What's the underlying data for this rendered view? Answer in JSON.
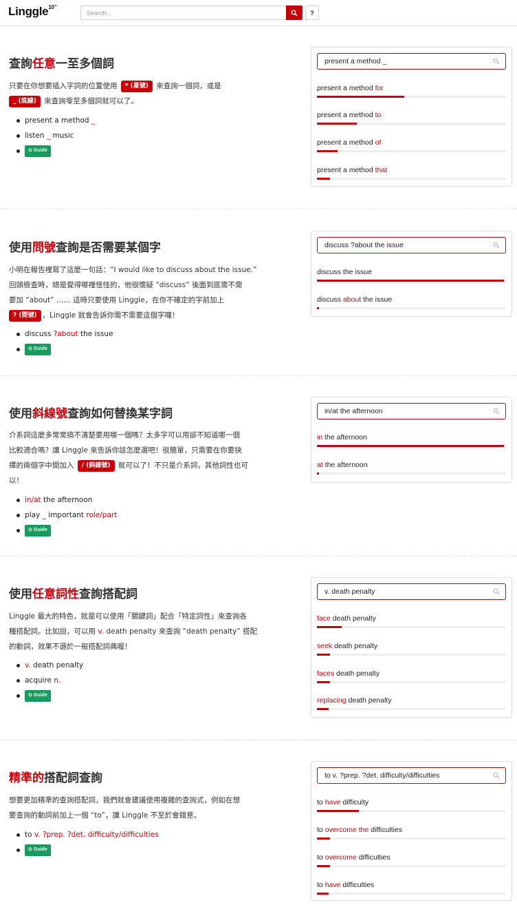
{
  "header": {
    "logo_text": "Linggle",
    "logo_sup": "10",
    "logo_mark": "\"",
    "search_placeholder": "Search...",
    "help_label": "?"
  },
  "colors": {
    "accent": "#c8000a",
    "guide": "#1a9a5c"
  },
  "guide_label": "Guide",
  "sections": [
    {
      "title": [
        "查詢",
        "任意",
        "一至多個詞"
      ],
      "body": [
        "只要在你想要插入字詞的位置使用",
        "* (星號)",
        "來查詢一個詞，或是",
        "_ (底線)",
        "來查詢零至多個詞就可以了。"
      ],
      "examples": [
        [
          "present a method ",
          "_"
        ],
        [
          "listen ",
          "_",
          " music"
        ]
      ],
      "panel": {
        "query": "present a method _",
        "results": [
          {
            "prefix": "present a method ",
            "hl": "for",
            "suffix": "",
            "ratio": 0.46
          },
          {
            "prefix": "present a method ",
            "hl": "to",
            "suffix": "",
            "ratio": 0.21
          },
          {
            "prefix": "present a method ",
            "hl": "of",
            "suffix": "",
            "ratio": 0.11
          },
          {
            "prefix": "present a method ",
            "hl": "that",
            "suffix": "",
            "ratio": 0.07
          }
        ]
      }
    },
    {
      "title": [
        "使用",
        "問號",
        "查詢是否需要某個字"
      ],
      "body": [
        "小明在報告裡寫了這麼一句話：“I would like to discuss about the issue.”",
        "回頭檢查時，總是覺得哪裡怪怪的，他很懷疑 “discuss” 後面到底需不需",
        "要加 “about” …… 這時只要使用 Linggle，在你不確定的字前加上",
        "? (問號)",
        "，Linggle 就會告訴你需不需要這個字囉！"
      ],
      "examples": [
        [
          "discuss ",
          "?about",
          " the issue"
        ]
      ],
      "panel": {
        "query": "discuss ?about the issue",
        "results": [
          {
            "prefix": "discuss the issue",
            "hl": "",
            "suffix": "",
            "ratio": 0.99
          },
          {
            "prefix": "discuss ",
            "hl": "about",
            "suffix": " the issue",
            "ratio": 0.01
          }
        ]
      }
    },
    {
      "title": [
        "使用",
        "斜線號",
        "查詢如何替換某字詞"
      ],
      "body": [
        "介系詞這麼多常常搞不清楚要用哪一個嗎？太多字可以用卻不知道哪一個",
        "比較適合嗎？讓 Linggle 來告訴你該怎麼選吧！很簡單，只需要在你要抉",
        "擇的兩個字中間加入",
        "/ (斜線號)",
        "就可以了！不只是介系詞，其他詞性也可",
        "以！"
      ],
      "examples": [
        [
          "",
          "in/at",
          " the afternoon"
        ],
        [
          "play _ important ",
          "role/part",
          ""
        ]
      ],
      "panel": {
        "query": "in/at the afternoon",
        "results": [
          {
            "prefix": "",
            "hl": "in",
            "suffix": " the afternoon",
            "ratio": 0.99
          },
          {
            "prefix": "",
            "hl": "at",
            "suffix": " the afternoon",
            "ratio": 0.01
          }
        ]
      }
    },
    {
      "title": [
        "使用",
        "任意詞性",
        "查詢搭配詞"
      ],
      "body": [
        "Linggle 最大的特色，就是可以使用「關鍵詞」配合「特定詞性」來查詢各",
        "種搭配詞。比如說，可以用",
        "v.",
        "death penalty 來查詢 “death penalty” 搭配",
        "的動詞，效果不遜於一般搭配詞典喔！"
      ],
      "examples": [
        [
          "",
          "v.",
          " death penalty"
        ],
        [
          "acquire ",
          "n.",
          ""
        ]
      ],
      "panel": {
        "query": "v. death penalty",
        "results": [
          {
            "prefix": "",
            "hl": "face",
            "suffix": " death penalty",
            "ratio": 0.13
          },
          {
            "prefix": "",
            "hl": "seek",
            "suffix": " death penalty",
            "ratio": 0.07
          },
          {
            "prefix": "",
            "hl": "faces",
            "suffix": " death penalty",
            "ratio": 0.07
          },
          {
            "prefix": "",
            "hl": "replacing",
            "suffix": " death penalty",
            "ratio": 0.06
          }
        ]
      }
    },
    {
      "title": [
        "",
        "精準的",
        "搭配詞查詢"
      ],
      "body": [
        "想要更加精準的查詢搭配詞，我們就會建議使用複雜的查詢式，例如在想",
        "要查詢的動詞前加上一個 “to”，讓 Linggle 不至於會錯意。"
      ],
      "examples": [
        [
          "to ",
          "v. ?prep. ?det. difficulty/difficulties",
          ""
        ]
      ],
      "panel": {
        "query": "to v. ?prep. ?det. difficulty/difficulties",
        "results": [
          {
            "prefix": "to ",
            "hl": "have",
            "suffix": " difficulty",
            "ratio": 0.22
          },
          {
            "prefix": "to ",
            "hl": "overcome the",
            "suffix": " difficulties",
            "ratio": 0.07
          },
          {
            "prefix": "to ",
            "hl": "overcome",
            "suffix": " difficulties",
            "ratio": 0.07
          },
          {
            "prefix": "to ",
            "hl": "have",
            "suffix": " difficulties",
            "ratio": 0.06
          }
        ]
      }
    }
  ]
}
